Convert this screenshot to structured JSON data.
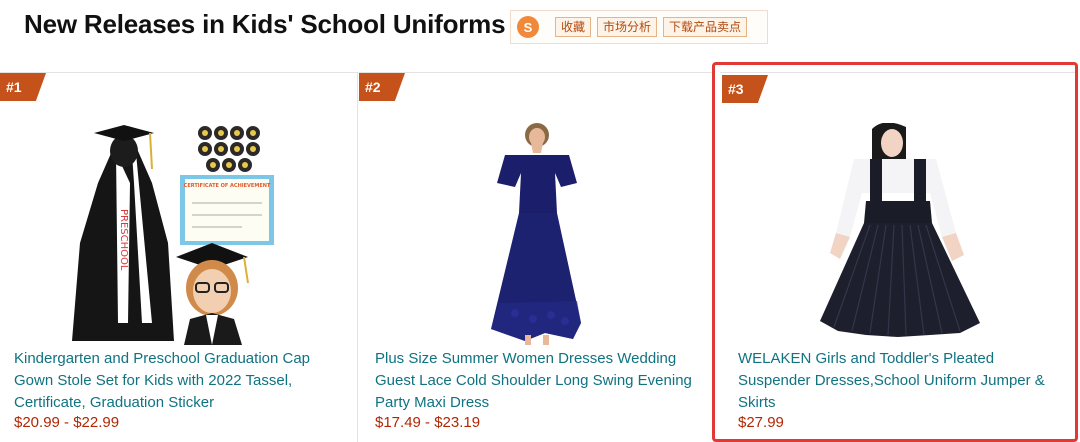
{
  "page": {
    "title": "New Releases in Kids' School Uniforms"
  },
  "extension_toolbar": {
    "logo_glyph": "S",
    "buttons": [
      "收藏",
      "市场分析",
      "下载产品卖点"
    ]
  },
  "colors": {
    "rank_badge": "#c4521a",
    "title_link": "#0f7382",
    "price": "#b12704",
    "highlight_border": "#e13a36",
    "extension_accent": "#f0893b"
  },
  "products": [
    {
      "rank": "#1",
      "title": "Kindergarten and Preschool Graduation Cap Gown Stole Set for Kids with 2022 Tassel, Certificate, Graduation Sticker",
      "price": "$20.99 - $22.99",
      "image": "graduation-gown-set-image",
      "image_text": {
        "stole": "PRESCHOOL",
        "certificate": "CERTIFICATE OF ACHIEVEMENT"
      }
    },
    {
      "rank": "#2",
      "title": "Plus Size Summer Women Dresses Wedding Guest Lace Cold Shoulder Long Swing Evening Party Maxi Dress",
      "price": "$17.49 - $23.19",
      "image": "navy-lace-maxi-dress-image"
    },
    {
      "rank": "#3",
      "title": "WELAKEN Girls and Toddler's Pleated Suspender Dresses,School Uniform Jumper & Skirts",
      "price": "$27.99",
      "image": "pleated-suspender-dress-image",
      "highlighted": true
    }
  ]
}
